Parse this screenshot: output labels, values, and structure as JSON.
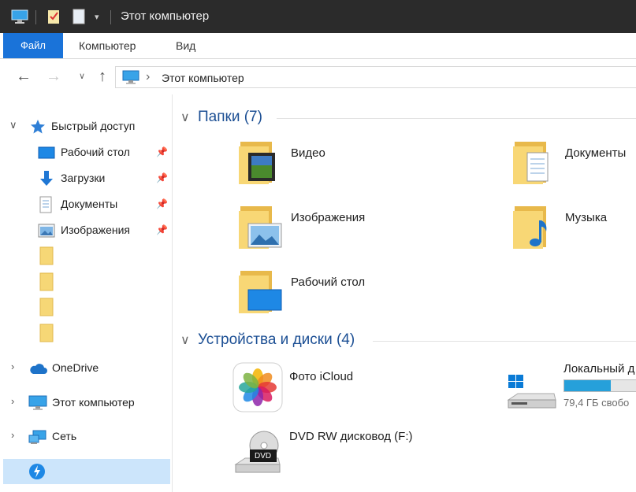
{
  "window": {
    "title": "Этот компьютер"
  },
  "ribbon": {
    "tabs": [
      {
        "label": "Файл"
      },
      {
        "label": "Компьютер"
      },
      {
        "label": "Вид"
      }
    ]
  },
  "address": {
    "path": "Этот компьютер"
  },
  "sidebar": {
    "quick_access": "Быстрый доступ",
    "items": [
      {
        "label": "Рабочий стол",
        "icon": "desktop-icon"
      },
      {
        "label": "Загрузки",
        "icon": "downloads-icon"
      },
      {
        "label": "Документы",
        "icon": "documents-icon"
      },
      {
        "label": "Изображения",
        "icon": "pictures-icon"
      }
    ],
    "onedrive": "OneDrive",
    "this_pc": "Этот компьютер",
    "network": "Сеть"
  },
  "content": {
    "folders_group": "Папки (7)",
    "folders": [
      {
        "name": "Видео",
        "icon": "video-folder-icon"
      },
      {
        "name": "Документы",
        "icon": "documents-folder-icon"
      },
      {
        "name": "Изображения",
        "icon": "pictures-folder-icon"
      },
      {
        "name": "Музыка",
        "icon": "music-folder-icon"
      },
      {
        "name": "Рабочий стол",
        "icon": "desktop-folder-icon"
      }
    ],
    "devices_group": "Устройства и диски (4)",
    "devices": [
      {
        "name": "Фото iCloud",
        "icon": "icloud-photos-icon"
      },
      {
        "name": "Локальный д",
        "sub": "79,4 ГБ свобо",
        "icon": "local-disk-icon",
        "used_fraction": 0.6
      },
      {
        "name": "DVD RW дисковод (F:)",
        "icon": "dvd-drive-icon",
        "badge": "DVD"
      }
    ]
  },
  "colors": {
    "accent": "#1a73d9",
    "title_bar": "#2b2b2b",
    "group_title": "#1c4f94",
    "selection": "#cce5fb",
    "disk_bar": "#26a0da"
  }
}
